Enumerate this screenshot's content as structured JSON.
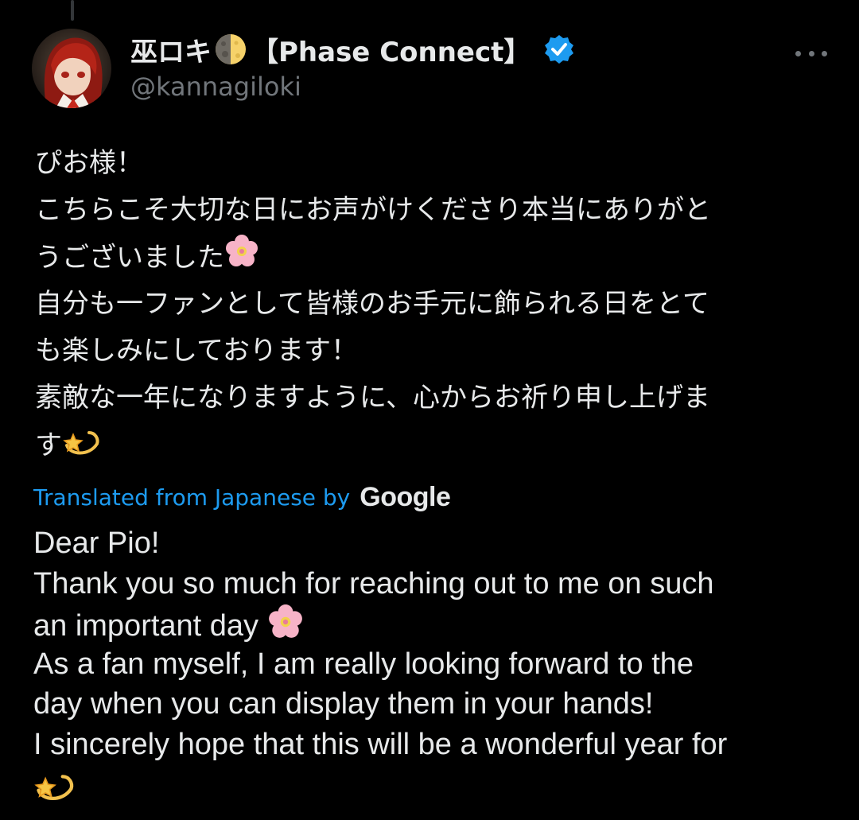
{
  "author": {
    "display_name_prefix": "巫ロキ",
    "display_name_suffix": "【Phase Connect】",
    "handle": "@kannagiloki",
    "verified": true,
    "icons": [
      "moon-icon",
      "verified-badge-icon"
    ]
  },
  "tweet": {
    "japanese_lines": [
      "ぴお様！",
      "こちらこそ大切な日にお声がけくださり本当にありがと",
      "うございました",
      "自分も一ファンとして皆様のお手元に飾られる日をとて",
      "も楽しみにしております！",
      "素敵な一年になりますように、心からお祈り申し上げま",
      "す"
    ],
    "translation_label": "Translated from Japanese by",
    "translation_provider": "Google",
    "english_lines": [
      "Dear Pio!",
      "Thank you so much for reaching out to me on such",
      "an important day",
      "As a fan myself, I am really looking forward to the",
      "day when you can display them in your hands!",
      "I sincerely hope that this will be a wonderful year for",
      ""
    ]
  },
  "colors": {
    "background": "#000000",
    "text": "#e7e9ea",
    "muted": "#71767b",
    "link": "#1d9bf0",
    "verified": "#1d9bf0"
  }
}
